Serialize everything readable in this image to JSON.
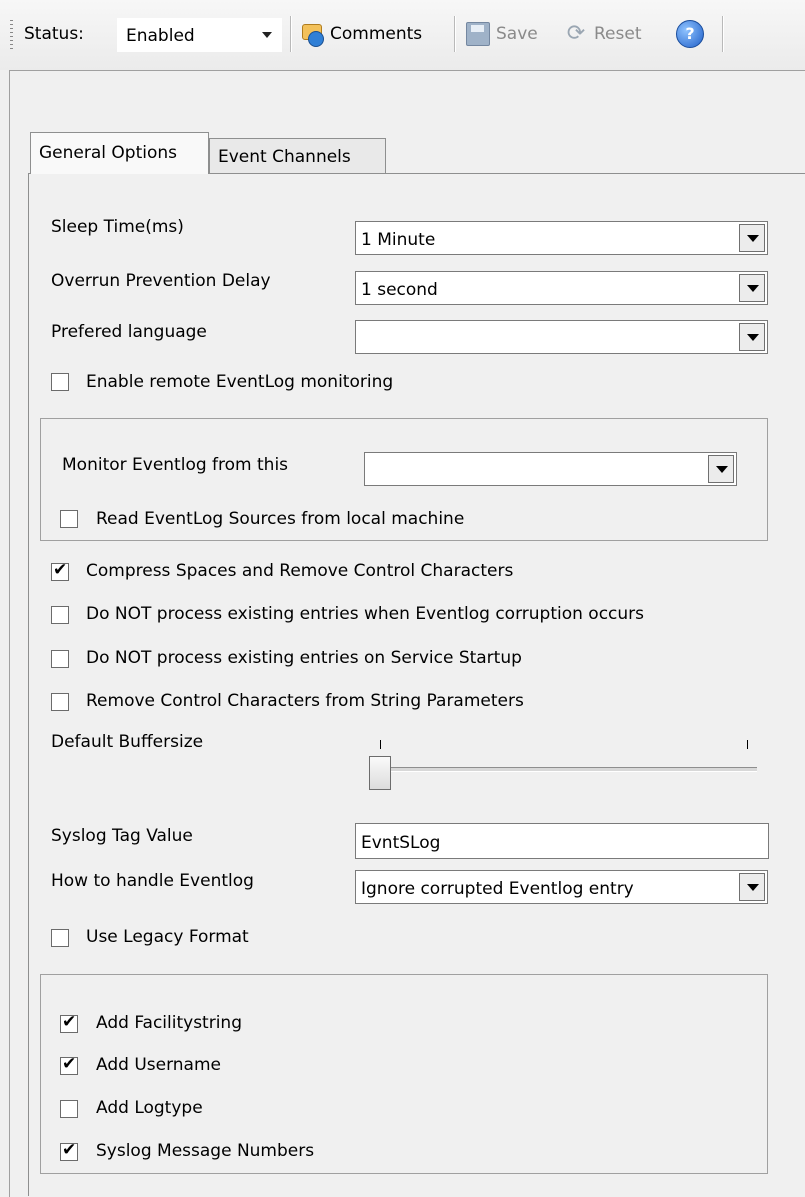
{
  "toolbar": {
    "status_label": "Status:",
    "status_value": "Enabled",
    "comments_label": "Comments",
    "save_label": "Save",
    "reset_label": "Reset",
    "help_icon": "help-icon"
  },
  "tabs": [
    {
      "label": "General Options",
      "active": true
    },
    {
      "label": "Event Channels",
      "active": false
    }
  ],
  "form": {
    "sleep_time_label": "Sleep Time(ms)",
    "sleep_time_value": "1 Minute",
    "overrun_label": "Overrun Prevention Delay",
    "overrun_value": "1 second",
    "language_label": "Prefered language",
    "language_value": "",
    "remote_monitoring_label": "Enable remote EventLog monitoring",
    "remote_monitoring_checked": false,
    "monitor_from_label": "Monitor Eventlog from this",
    "monitor_from_value": "",
    "read_sources_label": "Read EventLog Sources from local machine",
    "read_sources_checked": false,
    "compress_label": "Compress Spaces and Remove Control Characters",
    "compress_checked": true,
    "no_process_corruption_label": "Do NOT process existing entries when Eventlog corruption occurs",
    "no_process_corruption_checked": false,
    "no_process_startup_label": "Do NOT process existing entries on Service Startup",
    "no_process_startup_checked": false,
    "remove_control_label": "Remove Control Characters from String Parameters",
    "remove_control_checked": false,
    "buffersize_label": "Default Buffersize",
    "buffersize_position": 0,
    "syslog_tag_label": "Syslog Tag Value",
    "syslog_tag_value": "EvntSLog",
    "handle_eventlog_label": "How to handle Eventlog",
    "handle_eventlog_value": "Ignore corrupted Eventlog entry",
    "legacy_label": "Use Legacy Format",
    "legacy_checked": false,
    "add_facility_label": "Add Facilitystring",
    "add_facility_checked": true,
    "add_username_label": "Add Username",
    "add_username_checked": true,
    "add_logtype_label": "Add Logtype",
    "add_logtype_checked": false,
    "message_numbers_label": "Syslog Message Numbers",
    "message_numbers_checked": true
  }
}
